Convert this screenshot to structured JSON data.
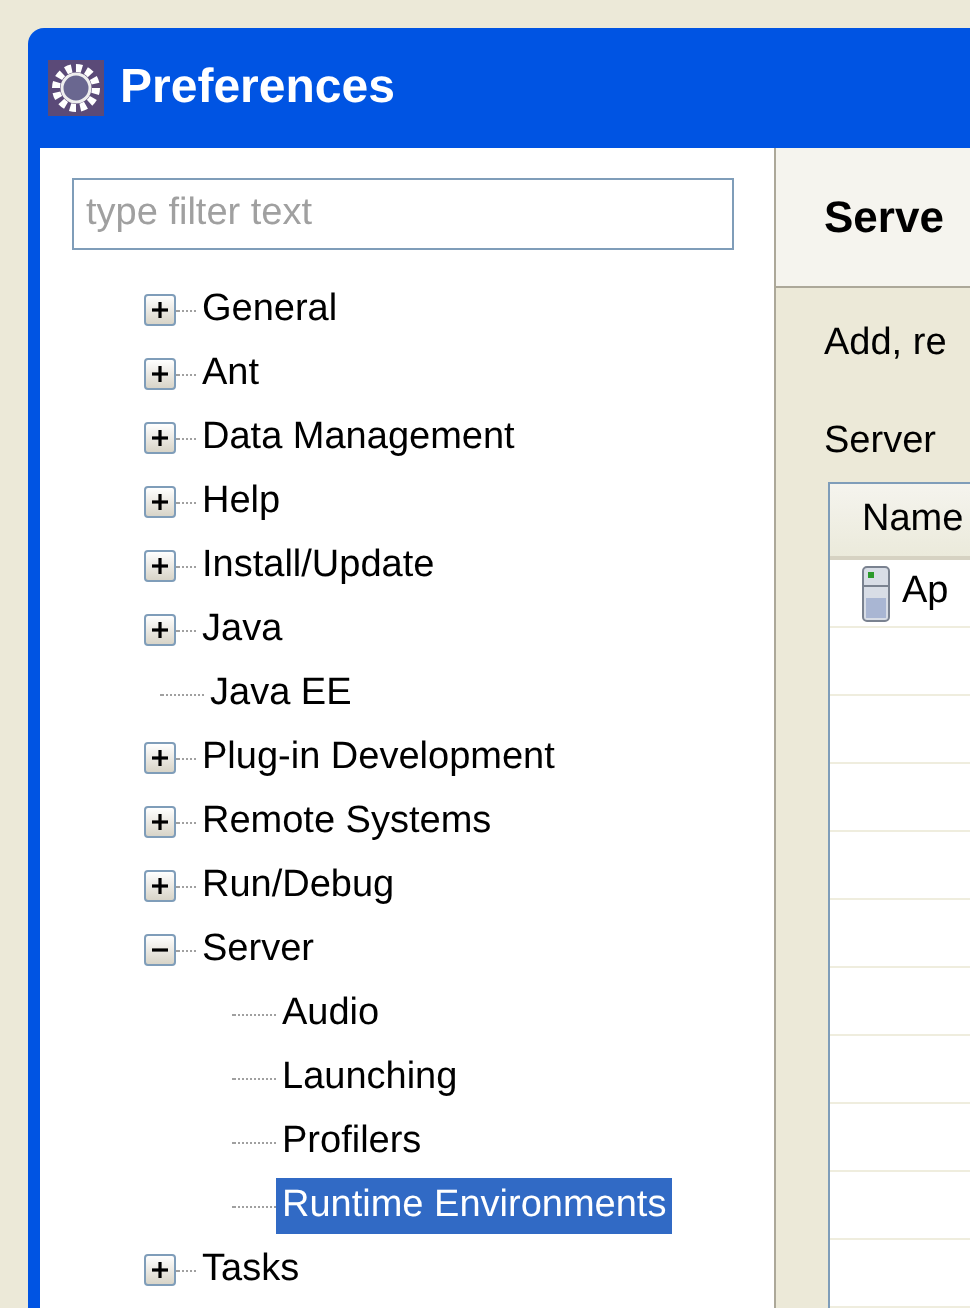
{
  "window": {
    "title": "Preferences"
  },
  "filter": {
    "placeholder": "type filter text"
  },
  "tree": [
    {
      "label": "General",
      "kind": "expandable",
      "expanded": false,
      "selected": false
    },
    {
      "label": "Ant",
      "kind": "expandable",
      "expanded": false,
      "selected": false
    },
    {
      "label": "Data Management",
      "kind": "expandable",
      "expanded": false,
      "selected": false
    },
    {
      "label": "Help",
      "kind": "expandable",
      "expanded": false,
      "selected": false
    },
    {
      "label": "Install/Update",
      "kind": "expandable",
      "expanded": false,
      "selected": false
    },
    {
      "label": "Java",
      "kind": "expandable",
      "expanded": false,
      "selected": false
    },
    {
      "label": "Java EE",
      "kind": "leaf",
      "selected": false
    },
    {
      "label": "Plug-in Development",
      "kind": "expandable",
      "expanded": false,
      "selected": false
    },
    {
      "label": "Remote Systems",
      "kind": "expandable",
      "expanded": false,
      "selected": false
    },
    {
      "label": "Run/Debug",
      "kind": "expandable",
      "expanded": false,
      "selected": false
    },
    {
      "label": "Server",
      "kind": "expandable",
      "expanded": true,
      "selected": false,
      "children": [
        {
          "label": "Audio",
          "kind": "leaf",
          "selected": false
        },
        {
          "label": "Launching",
          "kind": "leaf",
          "selected": false
        },
        {
          "label": "Profilers",
          "kind": "leaf",
          "selected": false
        },
        {
          "label": "Runtime Environments",
          "kind": "leaf",
          "selected": true
        }
      ]
    },
    {
      "label": "Tasks",
      "kind": "expandable",
      "expanded": false,
      "selected": false
    }
  ],
  "page": {
    "title": "Serve",
    "description": "Add, re",
    "list_label": "Server",
    "table": {
      "columns": [
        "Name"
      ],
      "rows": [
        {
          "cells": [
            "Ap"
          ]
        }
      ]
    }
  }
}
